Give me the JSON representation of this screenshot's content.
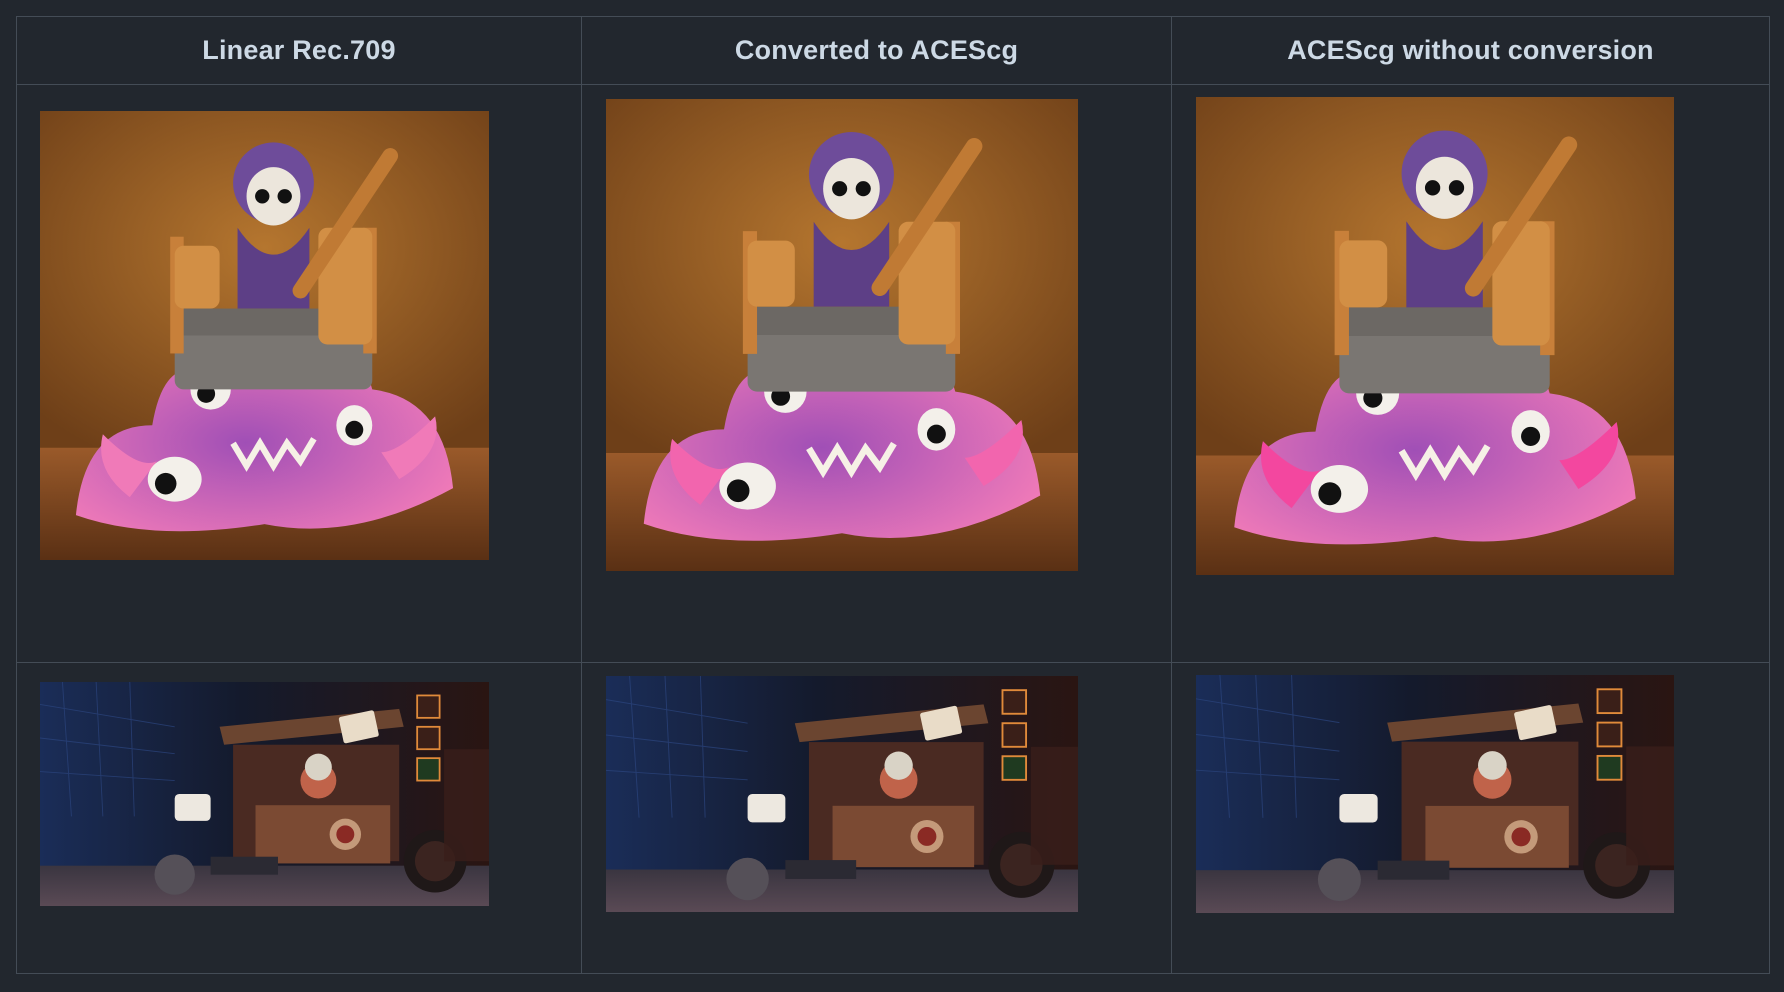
{
  "table": {
    "columns": [
      {
        "header": "Linear Rec.709",
        "variant": "linear"
      },
      {
        "header": "Converted to ACEScg",
        "variant": "converted"
      },
      {
        "header": "ACEScg without conversion",
        "variant": "unconverted"
      }
    ],
    "rows": [
      {
        "subject": "purple-slime-monster-under-bed"
      },
      {
        "subject": "junk-shop-robot-scene"
      }
    ]
  },
  "variant_colors": {
    "linear": {
      "wall": "#b5762f",
      "floor": "#9a5a2a",
      "slime": "#a04fb6",
      "slime_pink": "#f07ab8"
    },
    "converted": {
      "wall": "#b26a28",
      "floor": "#8f4f22",
      "slime": "#9a3fb0",
      "slime_pink": "#f265ae"
    },
    "unconverted": {
      "wall": "#b8742e",
      "floor": "#965426",
      "slime": "#c0389e",
      "slime_pink": "#f3479f"
    }
  }
}
